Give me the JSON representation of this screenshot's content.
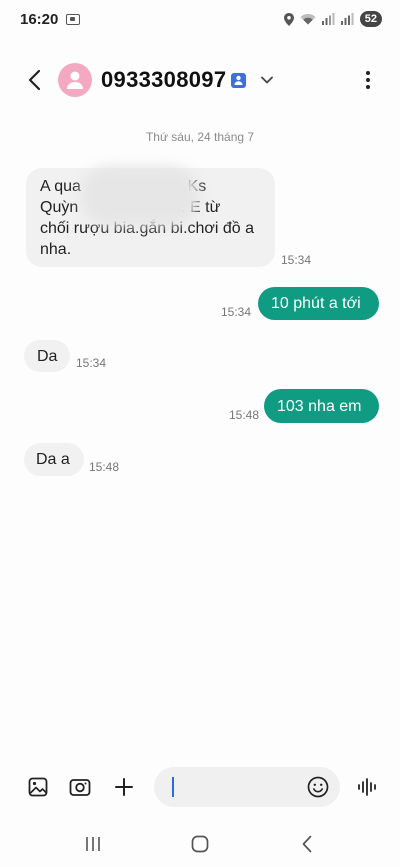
{
  "status_bar": {
    "time": "16:20",
    "battery": "52"
  },
  "header": {
    "contact_name": "0933308097"
  },
  "conversation": {
    "date": "Thứ sáu, 24 tháng 7",
    "messages": [
      {
        "direction": "incoming",
        "text": "A qua                       .Ks\nQuỳn         bình Tân. E từ\nchối rượu bia.gắn bi.chơi đồ a\nnha.",
        "time": "15:34"
      },
      {
        "direction": "outgoing",
        "text": "10 phút a tới",
        "time": "15:34"
      },
      {
        "direction": "incoming",
        "text": "Da",
        "time": "15:34"
      },
      {
        "direction": "outgoing",
        "text": "103 nha em",
        "time": "15:48"
      },
      {
        "direction": "incoming",
        "text": "Da a",
        "time": "15:48"
      }
    ]
  },
  "input": {
    "value": "",
    "icons": [
      "gallery-icon",
      "camera-icon",
      "plus-icon",
      "emoji-icon",
      "voice-icon"
    ]
  },
  "colors": {
    "outgoing_bubble": "#0f9c83",
    "incoming_bubble": "#f1f1f1",
    "avatar": "#f3a9c2",
    "cursor": "#2a6be3"
  }
}
